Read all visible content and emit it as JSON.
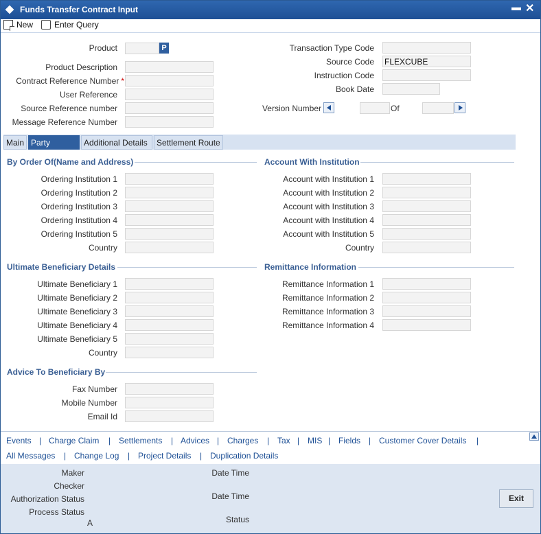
{
  "window": {
    "title": "Funds Transfer Contract Input"
  },
  "toolbar": {
    "new_label": "New",
    "enter_query_label": "Enter Query"
  },
  "header": {
    "product_label": "Product",
    "product_value": "",
    "product_btn": "P",
    "product_desc_label": "Product Description",
    "contract_ref_label": "Contract Reference Number",
    "required_mark": "*",
    "user_ref_label": "User Reference",
    "source_ref_label": "Source Reference number",
    "message_ref_label": "Message Reference Number",
    "txn_type_label": "Transaction Type Code",
    "source_code_label": "Source Code",
    "source_code_value": "FLEXCUBE",
    "instruction_code_label": "Instruction Code",
    "book_date_label": "Book Date",
    "version_label": "Version Number",
    "of_label": "Of"
  },
  "tabs": [
    "Main",
    "Party Details",
    "Additional Details",
    "Settlement Route"
  ],
  "by_order": {
    "title": "By Order Of(Name and Address)",
    "fields": [
      "Ordering Institution 1",
      "Ordering Institution 2",
      "Ordering Institution 3",
      "Ordering Institution 4",
      "Ordering Institution 5",
      "Country"
    ]
  },
  "account_with": {
    "title": "Account With Institution",
    "fields": [
      "Account with Institution 1",
      "Account with Institution 2",
      "Account with Institution 3",
      "Account with Institution 4",
      "Account with Institution 5",
      "Country"
    ]
  },
  "ultimate": {
    "title": "Ultimate Beneficiary Details",
    "fields": [
      "Ultimate Beneficiary 1",
      "Ultimate Beneficiary 2",
      "Ultimate Beneficiary 3",
      "Ultimate Beneficiary 4",
      "Ultimate Beneficiary 5",
      "Country"
    ]
  },
  "remittance": {
    "title": "Remittance Information",
    "fields": [
      "Remittance Information 1",
      "Remittance Information 2",
      "Remittance Information 3",
      "Remittance Information 4"
    ]
  },
  "advice": {
    "title": "Advice To Beneficiary By",
    "fields": [
      "Fax Number",
      "Mobile Number",
      "Email Id"
    ]
  },
  "footer": {
    "links_row1": [
      "Events",
      "Charge Claim",
      "Settlements",
      "Advices",
      "Charges",
      "Tax",
      "MIS",
      "Fields",
      "Customer Cover Details"
    ],
    "links_row2": [
      "All Messages",
      "Change Log",
      "Project Details",
      "Duplication Details"
    ],
    "separator": "|"
  },
  "audit": {
    "maker": "Maker",
    "checker": "Checker",
    "auth_status": "Authorization Status",
    "process_status": "Process Status",
    "date_time_1": "Date Time",
    "date_time_2": "Date Time",
    "status": "Status",
    "process_status_value": "A",
    "exit_label": "Exit"
  }
}
